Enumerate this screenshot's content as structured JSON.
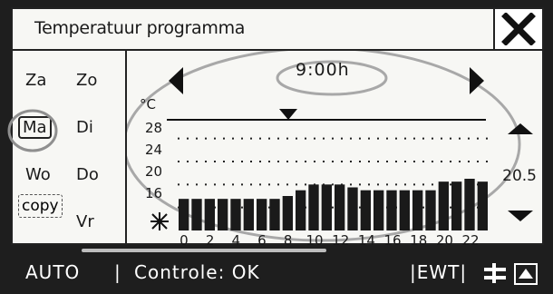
{
  "title": "Temperatuur programma",
  "time": "9:00h",
  "days": {
    "za": "Za",
    "zo": "Zo",
    "ma": "Ma",
    "di": "Di",
    "wo": "Wo",
    "do": "Do",
    "copy": "copy",
    "vr": "Vr"
  },
  "selected_day": "Ma",
  "setpoint": "20.5",
  "unit_label": "°C",
  "status": {
    "mode": "AUTO",
    "separator": "|",
    "text": "Controle: OK",
    "ewt": "|EWT|"
  },
  "colors": {
    "ink": "#1a1a1a",
    "screen": "#f7f7f4",
    "bar": "#1a1a1a"
  },
  "chart_data": {
    "type": "bar",
    "x_ticks": [
      "0",
      "2",
      "4",
      "6",
      "8",
      "10",
      "12",
      "14",
      "16",
      "18",
      "20",
      "22"
    ],
    "y_ticks": [
      "28",
      "24",
      "20",
      "16"
    ],
    "ylim": [
      12,
      30
    ],
    "hours": [
      0,
      1,
      2,
      3,
      4,
      5,
      6,
      7,
      8,
      9,
      10,
      11,
      12,
      13,
      14,
      15,
      16,
      17,
      18,
      19,
      20,
      21,
      22,
      23
    ],
    "values": [
      17.5,
      17.5,
      17.5,
      17.5,
      17.5,
      17.5,
      17.5,
      17.5,
      18,
      19,
      20,
      20,
      20,
      19.5,
      19,
      19,
      19,
      19,
      19,
      19,
      20.5,
      20.5,
      21,
      20.5
    ],
    "current_hour": 9,
    "grid": true
  }
}
